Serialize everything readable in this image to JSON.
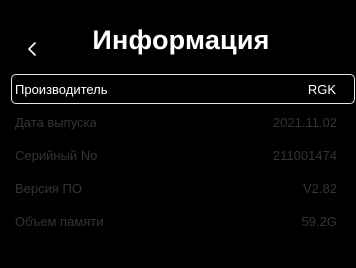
{
  "header": {
    "title": "Информация",
    "back_icon": "chevron-left-icon"
  },
  "items": [
    {
      "label": "Производитель",
      "value": "RGK",
      "selected": true
    },
    {
      "label": "Дата выпуска",
      "value": "2021.11.02",
      "selected": false
    },
    {
      "label": "Серийный No",
      "value": "211001474",
      "selected": false
    },
    {
      "label": "Версия ПО",
      "value": "V2.82",
      "selected": false
    },
    {
      "label": "Объем памяти",
      "value": "59.2G",
      "selected": false
    }
  ],
  "colors": {
    "background": "#000000",
    "text_active": "#ffffff",
    "text_inactive": "#343434",
    "selection_border": "#e6e6e6"
  }
}
